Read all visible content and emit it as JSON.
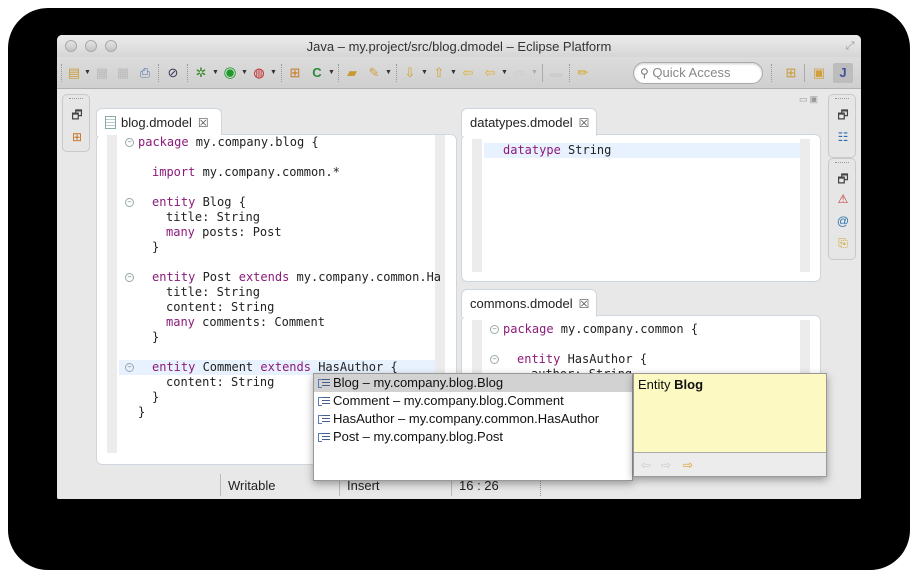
{
  "window": {
    "title": "Java – my.project/src/blog.dmodel – Eclipse Platform"
  },
  "toolbar": {
    "items": [
      {
        "name": "new-wizard",
        "glyph": "▤"
      },
      {
        "name": "save",
        "glyph": "▦"
      },
      {
        "name": "save-all",
        "glyph": "▦"
      },
      {
        "name": "print",
        "glyph": "⎙"
      },
      {
        "name": "skip-breakpoints",
        "glyph": "⊘"
      },
      {
        "name": "debug",
        "glyph": "✲"
      },
      {
        "name": "run",
        "glyph": "▶"
      },
      {
        "name": "run-external-tools",
        "glyph": "▶"
      },
      {
        "name": "new-java-package",
        "glyph": "⊞"
      },
      {
        "name": "new-java-class",
        "glyph": "C"
      },
      {
        "name": "open-type",
        "glyph": "📂"
      },
      {
        "name": "search",
        "glyph": "✎"
      },
      {
        "name": "next-annotation",
        "glyph": "⇩"
      },
      {
        "name": "previous-annotation",
        "glyph": "⇧"
      },
      {
        "name": "last-edit-location",
        "glyph": "⇦"
      },
      {
        "name": "back",
        "glyph": "⇦"
      },
      {
        "name": "forward",
        "glyph": "⇨"
      },
      {
        "name": "pin-editor",
        "glyph": "▬"
      },
      {
        "name": "toggle-mark-occurrences",
        "glyph": "✏"
      }
    ],
    "quick_access_placeholder": "Quick Access",
    "perspectives": [
      {
        "name": "open-perspective",
        "glyph": "⊞"
      },
      {
        "name": "resource-perspective",
        "glyph": "▣"
      },
      {
        "name": "java-perspective",
        "glyph": "J"
      }
    ]
  },
  "editors": {
    "blog": {
      "tab_label": "blog.dmodel",
      "lines": [
        {
          "fold": true,
          "indent": 0,
          "tokens": [
            {
              "t": "package",
              "kw": true
            },
            {
              "t": " my.company.blog {"
            }
          ]
        },
        {
          "indent": 0,
          "tokens": []
        },
        {
          "indent": 1,
          "tokens": [
            {
              "t": "import",
              "kw": true
            },
            {
              "t": " my.company.common.*"
            }
          ]
        },
        {
          "indent": 0,
          "tokens": []
        },
        {
          "fold": true,
          "indent": 1,
          "tokens": [
            {
              "t": "entity",
              "kw": true
            },
            {
              "t": " Blog {"
            }
          ]
        },
        {
          "indent": 2,
          "tokens": [
            {
              "t": "title: String"
            }
          ]
        },
        {
          "indent": 2,
          "tokens": [
            {
              "t": "many",
              "kw": true
            },
            {
              "t": " posts: Post"
            }
          ]
        },
        {
          "indent": 1,
          "tokens": [
            {
              "t": "}"
            }
          ]
        },
        {
          "indent": 0,
          "tokens": []
        },
        {
          "fold": true,
          "indent": 1,
          "tokens": [
            {
              "t": "entity",
              "kw": true
            },
            {
              "t": " Post "
            },
            {
              "t": "extends",
              "kw": true
            },
            {
              "t": " my.company.common.Ha"
            }
          ]
        },
        {
          "indent": 2,
          "tokens": [
            {
              "t": "title: String"
            }
          ]
        },
        {
          "indent": 2,
          "tokens": [
            {
              "t": "content: String"
            }
          ]
        },
        {
          "indent": 2,
          "tokens": [
            {
              "t": "many",
              "kw": true
            },
            {
              "t": " comments: Comment"
            }
          ]
        },
        {
          "indent": 1,
          "tokens": [
            {
              "t": "}"
            }
          ]
        },
        {
          "indent": 0,
          "tokens": []
        },
        {
          "fold": true,
          "current": true,
          "indent": 1,
          "tokens": [
            {
              "t": "entity",
              "kw": true
            },
            {
              "t": " Comment "
            },
            {
              "t": "extends",
              "kw": true
            },
            {
              "t": " HasAuthor {"
            }
          ]
        },
        {
          "indent": 2,
          "tokens": [
            {
              "t": "content: String"
            }
          ]
        },
        {
          "indent": 1,
          "tokens": [
            {
              "t": "}"
            }
          ]
        },
        {
          "indent": 0,
          "tokens": [
            {
              "t": "}"
            }
          ]
        }
      ]
    },
    "datatypes": {
      "tab_label": "datatypes.dmodel",
      "lines": [
        {
          "current": true,
          "indent": 0,
          "tokens": [
            {
              "t": "datatype",
              "kw": true
            },
            {
              "t": " String"
            }
          ]
        }
      ]
    },
    "commons": {
      "tab_label": "commons.dmodel",
      "lines": [
        {
          "fold": true,
          "indent": 0,
          "tokens": [
            {
              "t": "package",
              "kw": true
            },
            {
              "t": " my.company.common {"
            }
          ]
        },
        {
          "indent": 0,
          "tokens": []
        },
        {
          "fold": true,
          "indent": 1,
          "tokens": [
            {
              "t": "entity",
              "kw": true
            },
            {
              "t": " HasAuthor {"
            }
          ]
        },
        {
          "indent": 2,
          "tokens": [
            {
              "t": "author: String"
            }
          ]
        }
      ]
    }
  },
  "content_assist": {
    "proposals": [
      {
        "label": "Blog – my.company.blog.Blog",
        "selected": true
      },
      {
        "label": "Comment – my.company.blog.Comment",
        "selected": false
      },
      {
        "label": "HasAuthor – my.company.common.HasAuthor",
        "selected": false
      },
      {
        "label": "Post – my.company.blog.Post",
        "selected": false
      }
    ],
    "doc": {
      "prefix": "Entity",
      "name": "Blog"
    }
  },
  "statusbar": {
    "writable": "Writable",
    "insert_mode": "Insert",
    "position": "16 : 26"
  },
  "icons": {
    "close_tab": "☒",
    "minimize": "▭",
    "maximize": "▣",
    "restore": "🗗",
    "search": "🔍"
  }
}
